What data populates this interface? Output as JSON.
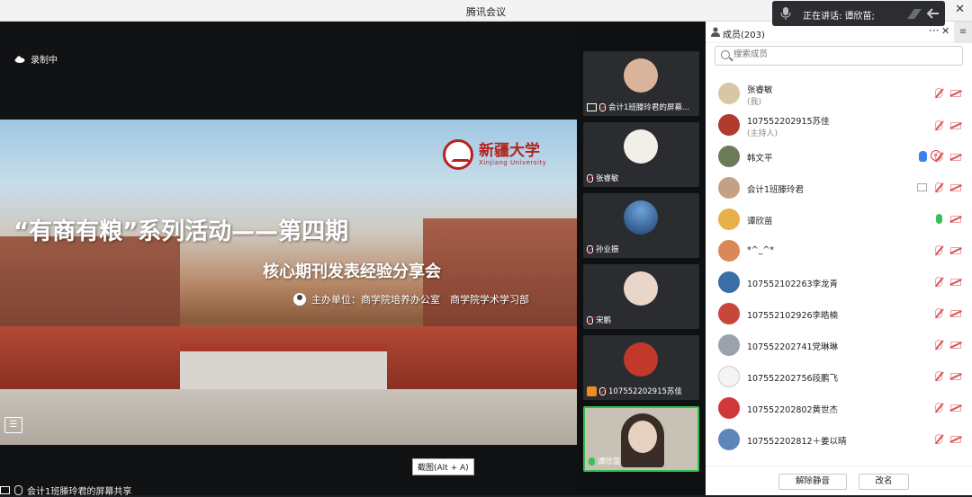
{
  "window": {
    "title": "腾讯会议",
    "close_glyph": "✕"
  },
  "speaking": {
    "label": "正在讲话: 谭欣苗;"
  },
  "main": {
    "recording_label": "录制中",
    "slide": {
      "university_cn": "新疆大学",
      "university_en": "Xinjiang University",
      "title": "“有商有粮”系列活动——第四期",
      "subtitle": "核心期刊发表经验分享会",
      "organizer": "主办单位：商学院培养办公室　商学院学术学习部"
    },
    "tooltip": "截图(Alt + A)",
    "bottom_label": "会计1班滕玲君的屏幕共享"
  },
  "video_tiles": [
    {
      "label": "会计1班滕玲君的屏幕...",
      "avatar_color": "#d9b49a",
      "screen": true,
      "muted": true
    },
    {
      "label": "张睿敏",
      "avatar_color": "#f2efe8",
      "muted": true
    },
    {
      "label": "孙业振",
      "avatar_color": "#2b5f9e",
      "muted": true
    },
    {
      "label": "宋鹏",
      "avatar_color": "#e9d6c8",
      "muted": true
    },
    {
      "label": "107552202915苏佳",
      "avatar_color": "#c0392b",
      "host": true,
      "muted": true
    },
    {
      "label": "谭欣苗",
      "avatar_color": "#c8b7a2",
      "active": true,
      "muted": false
    }
  ],
  "members_panel": {
    "header": "成员(203)",
    "more_glyph": "···",
    "close_glyph": "✕",
    "side_glyph": "≡",
    "search_placeholder": "搜索成员",
    "members": [
      {
        "name": "张睿敏",
        "role": "(我)",
        "avatar_color": "#d8c7a5",
        "icons": [
          "micoff",
          "cam"
        ]
      },
      {
        "name": "107552202915苏佳",
        "role": "(主持人)",
        "avatar_color": "#b03a2e",
        "icons": [
          "rec",
          "micoff",
          "cam"
        ]
      },
      {
        "name": "韩文平",
        "role": "",
        "avatar_color": "#6b7b5a",
        "icons": [
          "hand",
          "micoff",
          "cam"
        ]
      },
      {
        "name": "会计1班滕玲君",
        "role": "",
        "avatar_color": "#c4a184",
        "icons": [
          "screen",
          "micoff",
          "cam"
        ]
      },
      {
        "name": "谭欣苗",
        "role": "",
        "avatar_color": "#e8b04a",
        "icons": [
          "micon",
          "cam"
        ]
      },
      {
        "name": "*^_^*",
        "role": "",
        "avatar_color": "#d9885a",
        "icons": [
          "micoff",
          "cam"
        ]
      },
      {
        "name": "107552102263李龙青",
        "role": "",
        "avatar_color": "#3a6ea5",
        "icons": [
          "micoff",
          "cam"
        ]
      },
      {
        "name": "107552102926李皓楠",
        "role": "",
        "avatar_color": "#c9463d",
        "icons": [
          "micoff",
          "cam"
        ]
      },
      {
        "name": "107552202741党琳琳",
        "role": "",
        "avatar_color": "#9aa3ad",
        "icons": [
          "micoff",
          "cam"
        ]
      },
      {
        "name": "107552202756段鹏飞",
        "role": "",
        "avatar_color": "#f4f4f4",
        "icons": [
          "micoff",
          "cam"
        ]
      },
      {
        "name": "107552202802黄世杰",
        "role": "",
        "avatar_color": "#d1383a",
        "icons": [
          "micoff",
          "cam"
        ]
      },
      {
        "name": "107552202812＋姜以晴",
        "role": "",
        "avatar_color": "#5f86b8",
        "icons": [
          "micoff",
          "cam"
        ]
      }
    ],
    "unmute_all": "解除静音",
    "rename": "改名"
  }
}
